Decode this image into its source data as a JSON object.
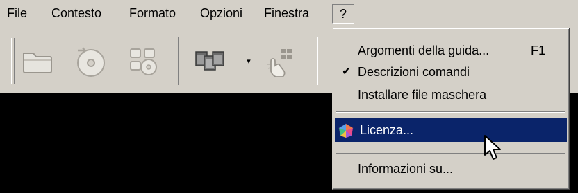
{
  "menubar": {
    "items": [
      {
        "label": "File"
      },
      {
        "label": "Contesto"
      },
      {
        "label": "Formato"
      },
      {
        "label": "Opzioni"
      },
      {
        "label": "Finestra"
      },
      {
        "label": "?"
      }
    ],
    "active_index": 5
  },
  "toolbar": {
    "buttons": [
      {
        "icon": "open-folder-icon"
      },
      {
        "icon": "cd-disc-icon"
      },
      {
        "icon": "multi-disc-icon"
      },
      {
        "icon": "windows-arrange-icon"
      },
      {
        "icon": "touch-hand-icon"
      }
    ],
    "dropdown_arrow": "▾"
  },
  "help_menu": {
    "items": [
      {
        "label": "Argomenti della guida...",
        "shortcut": "F1"
      },
      {
        "label": "Descrizioni comandi",
        "checked": true,
        "check_glyph": "✔"
      },
      {
        "label": "Installare file maschera"
      },
      {
        "label": "Licenza...",
        "icon": "license-gem-icon",
        "highlighted": true
      },
      {
        "label": "Informazioni su..."
      }
    ]
  },
  "colors": {
    "face": "#d4d0c8",
    "highlight": "#0a246a",
    "content_bg": "#000000"
  }
}
